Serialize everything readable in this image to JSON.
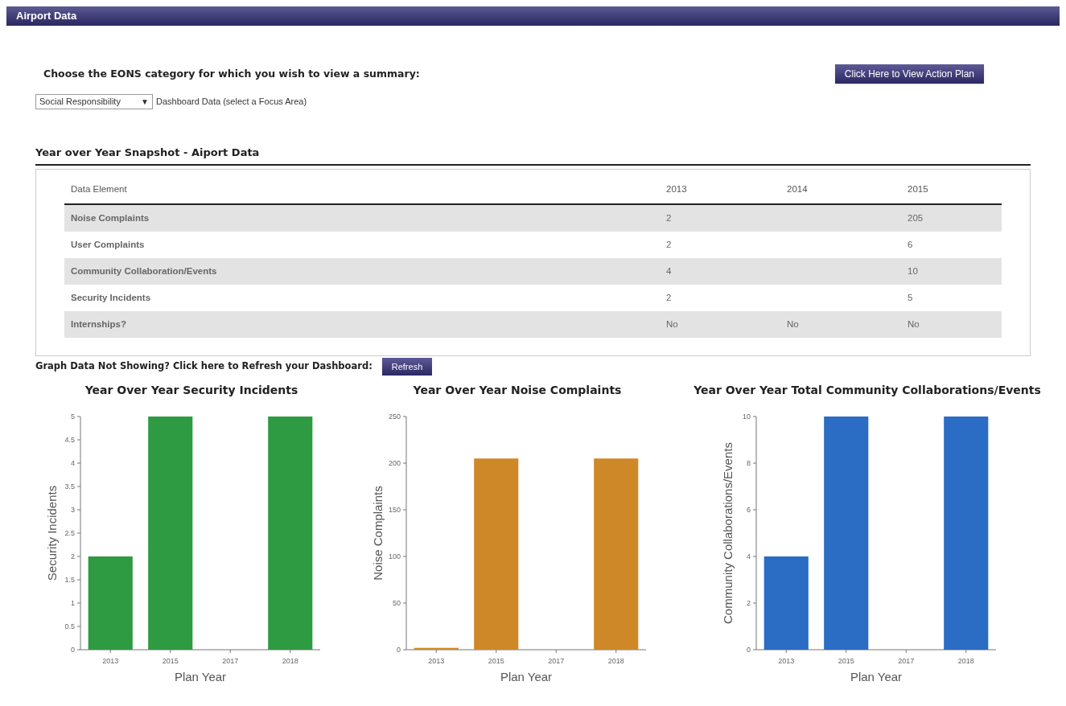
{
  "header": {
    "title": "Airport Data"
  },
  "prompt": "Choose the EONS category for which you wish to view a summary:",
  "action_button": "Click Here to View Action Plan",
  "category_select": {
    "value": "Social Responsibility",
    "arrow": "▼",
    "hint": "Dashboard Data (select a Focus Area)"
  },
  "snapshot": {
    "title": "Year over Year Snapshot - Aiport Data",
    "columns": [
      "Data Element",
      "2013",
      "2014",
      "2015"
    ],
    "rows": [
      [
        "Noise Complaints",
        "2",
        "",
        "205"
      ],
      [
        "User Complaints",
        "2",
        "",
        "6"
      ],
      [
        "Community Collaboration/Events",
        "4",
        "",
        "10"
      ],
      [
        "Security Incidents",
        "2",
        "",
        "5"
      ],
      [
        "Internships?",
        "No",
        "No",
        "No"
      ]
    ]
  },
  "refresh": {
    "text": "Graph Data Not Showing? Click here to Refresh your Dashboard:",
    "button": "Refresh"
  },
  "charts": [
    {
      "chart_data": {
        "type": "bar",
        "title": "Year Over Year Security Incidents",
        "xlabel": "Plan Year",
        "ylabel": "Security Incidents",
        "categories": [
          "2013",
          "2015",
          "2017",
          "2018"
        ],
        "series": [
          {
            "color": "#2e9a42",
            "values": [
              2,
              5,
              null,
              5
            ]
          }
        ],
        "ylim": [
          0,
          5
        ],
        "yticks": [
          0,
          {
            "value": 0.5,
            "label": "0.5"
          },
          1,
          {
            "value": 1.5,
            "label": "1.5"
          },
          2,
          {
            "value": 2.5,
            "label": "2.5"
          },
          3,
          {
            "value": 3.5,
            "label": "3.5"
          },
          4,
          {
            "value": 4.5,
            "label": "4.5"
          },
          5
        ]
      }
    },
    {
      "chart_data": {
        "type": "bar",
        "title": "Year Over Year Noise Complaints",
        "xlabel": "Plan Year",
        "ylabel": "Noise Complaints",
        "categories": [
          "2013",
          "2015",
          "2017",
          "2018"
        ],
        "series": [
          {
            "color": "#cf8827",
            "values": [
              2,
              205,
              null,
              205
            ]
          }
        ],
        "ylim": [
          0,
          250
        ],
        "yticks": [
          0,
          50,
          100,
          150,
          200,
          250
        ]
      }
    },
    {
      "chart_data": {
        "type": "bar",
        "title": "Year Over Year Total Community Collaborations/Events",
        "xlabel": "Plan Year",
        "ylabel": "Community Collaborations/Events",
        "categories": [
          "2013",
          "2015",
          "2017",
          "2018"
        ],
        "series": [
          {
            "color": "#2b6cc4",
            "values": [
              4,
              10,
              null,
              10
            ]
          }
        ],
        "ylim": [
          0,
          10
        ],
        "yticks": [
          0,
          2,
          4,
          6,
          8,
          10
        ]
      }
    }
  ]
}
